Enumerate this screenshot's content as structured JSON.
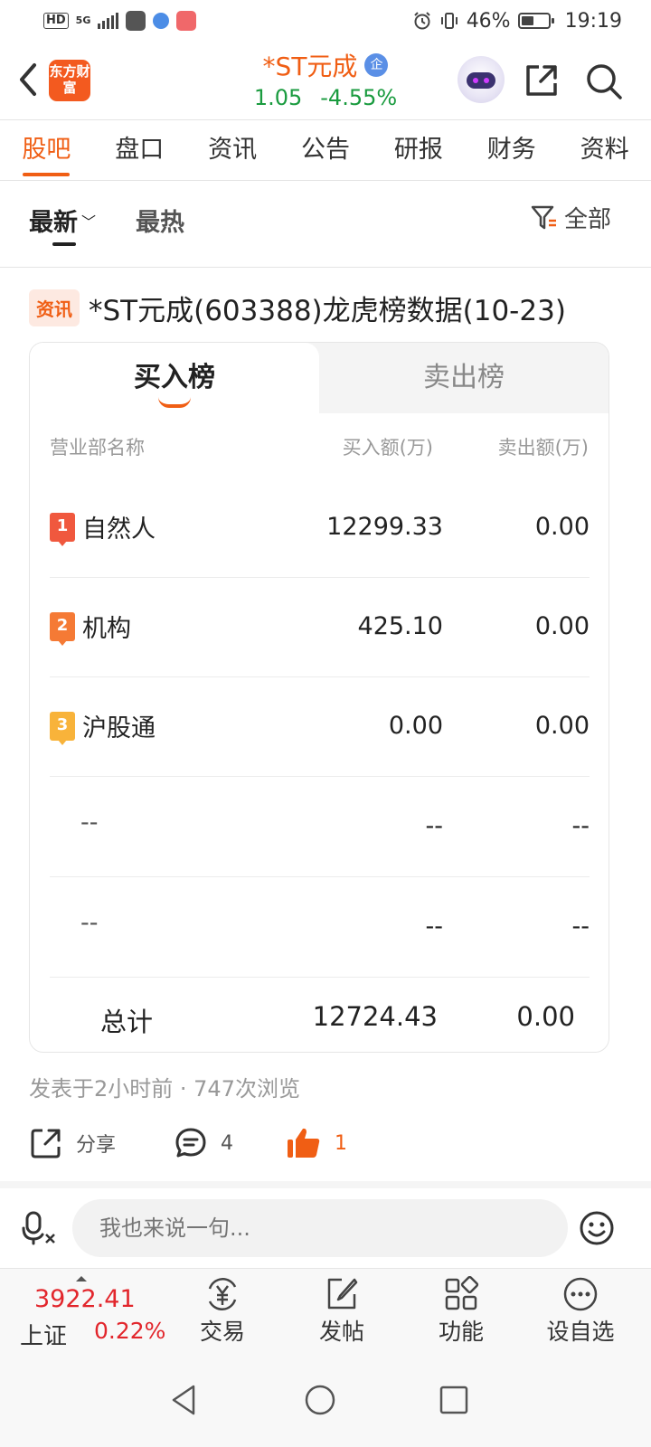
{
  "status_bar": {
    "hd": "HD",
    "network": "5G",
    "battery": "46%",
    "time": "19:19"
  },
  "header": {
    "brand_logo_text": "东方财富",
    "stock_name": "*ST元成",
    "enterprise_badge": "企",
    "price": "1.05",
    "change_pct": "-4.55%"
  },
  "tabs": [
    {
      "label": "股吧",
      "active": true
    },
    {
      "label": "盘口"
    },
    {
      "label": "资讯"
    },
    {
      "label": "公告"
    },
    {
      "label": "研报"
    },
    {
      "label": "财务"
    },
    {
      "label": "资料"
    }
  ],
  "sort": {
    "latest": "最新",
    "hot": "最热",
    "filter": "全部"
  },
  "post": {
    "tag": "资讯",
    "title": "*ST元成(603388)龙虎榜数据(10-23)",
    "card": {
      "tab_buy": "买入榜",
      "tab_sell": "卖出榜",
      "columns": [
        "营业部名称",
        "买入额(万)",
        "卖出额(万)"
      ],
      "rows": [
        {
          "rank": "1",
          "name": "自然人",
          "buy": "12299.33",
          "sell": "0.00"
        },
        {
          "rank": "2",
          "name": "机构",
          "buy": "425.10",
          "sell": "0.00"
        },
        {
          "rank": "3",
          "name": "沪股通",
          "buy": "0.00",
          "sell": "0.00"
        },
        {
          "rank": "",
          "name": "--",
          "buy": "--",
          "sell": "--"
        },
        {
          "rank": "",
          "name": "--",
          "buy": "--",
          "sell": "--"
        }
      ],
      "total_label": "总计",
      "total_buy": "12724.43",
      "total_sell": "0.00"
    },
    "meta": "发表于2小时前 · 747次浏览",
    "actions": {
      "share_label": "分享",
      "comment_count": "4",
      "like_count": "1"
    }
  },
  "comment_bar": {
    "placeholder": "我也来说一句..."
  },
  "bottom_bar": {
    "index_value": "3922.41",
    "index_name": "上证",
    "index_pct": "0.22%",
    "trade": "交易",
    "post": "发帖",
    "functions": "功能",
    "watchlist": "设自选"
  },
  "colors": {
    "accent": "#f05e14",
    "down_green": "#1a9b3f",
    "up_red": "#e2262c"
  },
  "icons": [
    "back-arrow-icon",
    "share-icon",
    "search-icon",
    "filter-icon",
    "chevron-down-icon",
    "comment-icon",
    "thumbs-up-icon",
    "voice-icon",
    "emoji-icon",
    "yuan-exchange-icon",
    "edit-icon",
    "grid-icon",
    "more-circle-icon",
    "nav-back-icon",
    "nav-home-icon",
    "nav-recents-icon"
  ]
}
